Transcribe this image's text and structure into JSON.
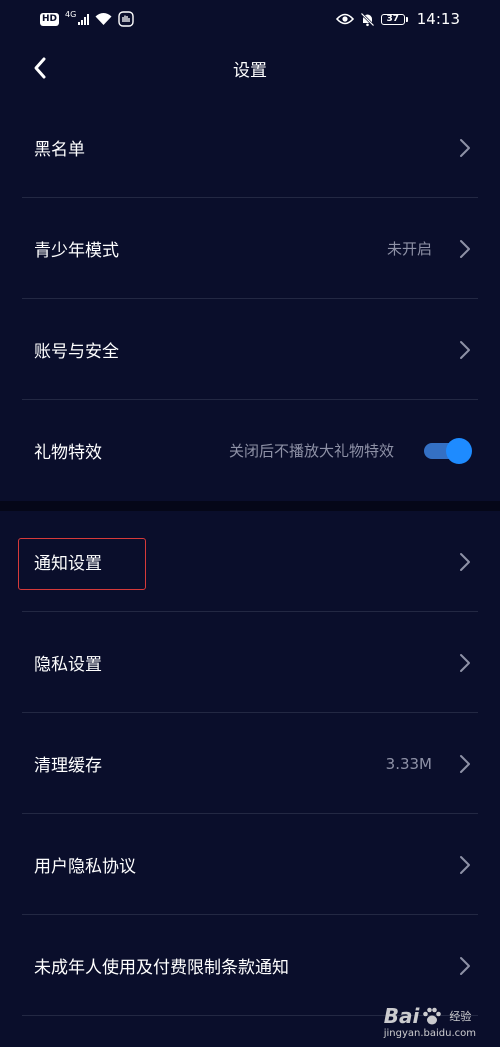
{
  "status_bar": {
    "hd_label": "HD",
    "network": "4G",
    "battery": "37",
    "time": "14:13"
  },
  "header": {
    "title": "设置"
  },
  "group1": [
    {
      "label": "黑名单",
      "value": ""
    },
    {
      "label": "青少年模式",
      "value": "未开启"
    },
    {
      "label": "账号与安全",
      "value": ""
    },
    {
      "label": "礼物特效",
      "value": "关闭后不播放大礼物特效",
      "toggle_on": true
    }
  ],
  "group2": [
    {
      "label": "通知设置",
      "value": "",
      "highlighted": true
    },
    {
      "label": "隐私设置",
      "value": ""
    },
    {
      "label": "清理缓存",
      "value": "3.33M"
    },
    {
      "label": "用户隐私协议",
      "value": ""
    },
    {
      "label": "未成年人使用及付费限制条款通知",
      "value": ""
    }
  ],
  "watermark": {
    "brand": "Bai",
    "brand_tail": "经验",
    "url": "jingyan.baidu.com"
  },
  "colors": {
    "background": "#0a0e2b",
    "toggle_accent": "#1e8bff",
    "highlight_border": "#d63a3a"
  }
}
